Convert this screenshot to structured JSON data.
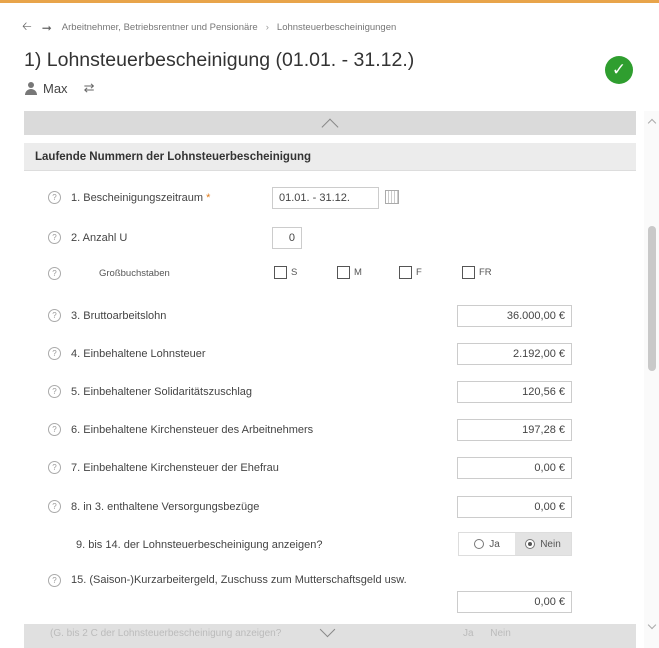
{
  "breadcrumb": {
    "back_icon": "arrow-left-icon",
    "forward_icon": "arrow-right-icon",
    "items": [
      "Arbeitnehmer, Betriebsrentner und Pensionäre",
      "Lohnsteuerbescheinigungen"
    ],
    "separator": "›"
  },
  "header": {
    "title": "1) Lohnsteuerbescheinigung (01.01. - 31.12.)",
    "status_icon": "checkmark-circle-icon",
    "status_color": "#2f9e2f",
    "user_name": "Max",
    "swap_icon": "swap-icon"
  },
  "section": {
    "title": "Laufende Nummern der Lohnsteuerbescheinigung"
  },
  "fields": {
    "f1": {
      "label": "1. Bescheinigungszeitraum",
      "required_mark": "*",
      "value": "01.01. - 31.12."
    },
    "f2": {
      "label": "2. Anzahl U",
      "value": "0"
    },
    "f_gross": {
      "label": "Großbuchstaben",
      "options": [
        "S",
        "M",
        "F",
        "FR"
      ]
    },
    "f3": {
      "label": "3. Bruttoarbeitslohn",
      "value": "36.000,00 €"
    },
    "f4": {
      "label": "4. Einbehaltene Lohnsteuer",
      "value": "2.192,00 €"
    },
    "f5": {
      "label": "5. Einbehaltener Solidaritätszuschlag",
      "value": "120,56 €"
    },
    "f6": {
      "label": "6. Einbehaltene Kirchensteuer des Arbeitnehmers",
      "value": "197,28 €"
    },
    "f7": {
      "label": "7. Einbehaltene Kirchensteuer der Ehefrau",
      "value": "0,00 €"
    },
    "f8": {
      "label": "8. in 3. enthaltene Versorgungsbezüge",
      "value": "0,00 €"
    },
    "f9": {
      "label": "9. bis 14. der Lohnsteuerbescheinigung anzeigen?",
      "option_yes": "Ja",
      "option_no": "Nein",
      "selected": "Nein"
    },
    "f15": {
      "label": "15. (Saison-)Kurzarbeitergeld, Zuschuss zum Mutterschaftsgeld usw.",
      "value": "0,00 €"
    }
  },
  "bottom": {
    "ghost_text": "(G. bis 2 C der Lohnsteuerbescheinigung anzeigen?",
    "ghost_yes": "Ja",
    "ghost_no": "Nein"
  },
  "colors": {
    "accent_top": "#e8a44a",
    "required": "#e07b1c",
    "section_bg": "#ececec",
    "bar_bg": "#dadada"
  }
}
